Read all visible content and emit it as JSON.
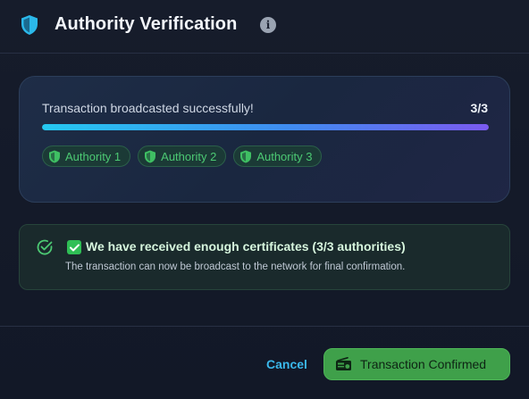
{
  "header": {
    "title": "Authority Verification",
    "shield_icon": "shield-icon",
    "info_icon": "info-icon",
    "info_glyph": "i"
  },
  "progress": {
    "status": "Transaction broadcasted successfully!",
    "count": "3/3",
    "fraction": 1.0,
    "authorities": [
      {
        "label": "Authority 1"
      },
      {
        "label": "Authority 2"
      },
      {
        "label": "Authority 3"
      }
    ]
  },
  "notice": {
    "headline": "We have received enough certificates (3/3 authorities)",
    "detail": "The transaction can now be broadcast to the network for final confirmation."
  },
  "footer": {
    "cancel_label": "Cancel",
    "confirm_label": "Transaction Confirmed",
    "confirm_icon": "radio-icon"
  },
  "colors": {
    "accent_blue": "#3ab8ec",
    "success_green": "#3fa04a",
    "chip_green": "#4cc973"
  }
}
